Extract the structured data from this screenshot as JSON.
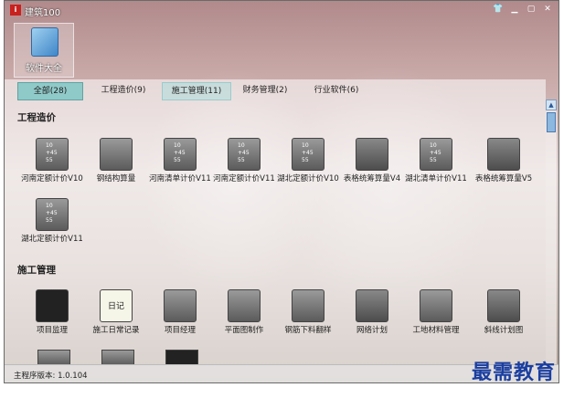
{
  "window": {
    "title": "建筑100",
    "logo_text": "i"
  },
  "top_tiles": [
    {
      "label": "软件大全"
    }
  ],
  "tabs": [
    {
      "label": "全部(28)"
    },
    {
      "label": "工程造价(9)"
    },
    {
      "label": "施工管理(11)"
    },
    {
      "label": "财务管理(2)"
    },
    {
      "label": "行业软件(6)"
    }
  ],
  "sections": [
    {
      "title": "工程造价",
      "apps": [
        {
          "label": "河南定额计价V10"
        },
        {
          "label": "钢结构算量"
        },
        {
          "label": "河南清单计价V11"
        },
        {
          "label": "河南定额计价V11"
        },
        {
          "label": "湖北定额计价V10"
        },
        {
          "label": "表格统筹算量V4"
        },
        {
          "label": "湖北清单计价V11"
        },
        {
          "label": "表格统筹算量V5"
        },
        {
          "label": "湖北定额计价V11"
        }
      ]
    },
    {
      "title": "施工管理",
      "apps": [
        {
          "label": "项目监理"
        },
        {
          "label": "施工日常记录"
        },
        {
          "label": "项目经理"
        },
        {
          "label": "平面图制作"
        },
        {
          "label": "钢筋下料翻样"
        },
        {
          "label": "网络计划"
        },
        {
          "label": "工地材料管理"
        },
        {
          "label": "斜线计划图"
        }
      ]
    }
  ],
  "icon_text": {
    "calc_line1": "10",
    "calc_line2": "45",
    "calc_line3": "55",
    "diary": "日记"
  },
  "status": {
    "version": "主程序版本: 1.0.104"
  },
  "watermark": "最需教育",
  "colors": {
    "tab_active": "#8fc9c8",
    "watermark": "#1a3ea0"
  }
}
